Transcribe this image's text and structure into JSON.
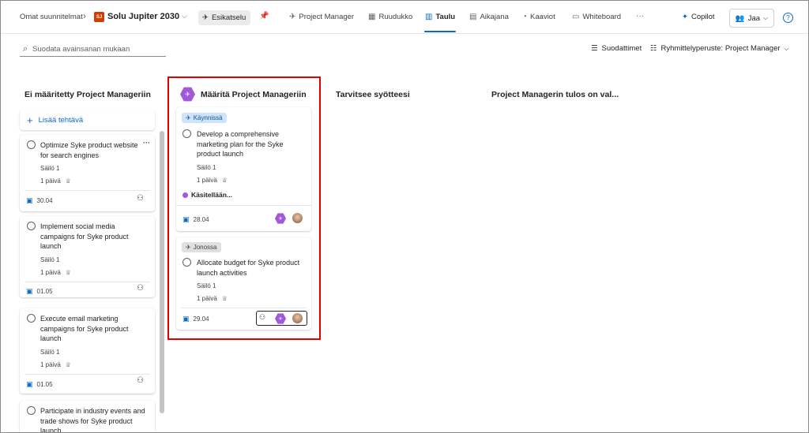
{
  "header": {
    "breadcrumb": "Omat suunnitelmat",
    "plan_initials": "SJ",
    "plan_name": "Solu Jupiter 2030",
    "preview_label": "Esikatselu",
    "tabs": [
      {
        "label": "Project Manager",
        "icon": "rocket-icon"
      },
      {
        "label": "Ruudukko",
        "icon": "grid-icon"
      },
      {
        "label": "Taulu",
        "icon": "board-icon"
      },
      {
        "label": "Aikajana",
        "icon": "timeline-icon"
      },
      {
        "label": "Kaaviot",
        "icon": "chart-icon"
      },
      {
        "label": "Whiteboard",
        "icon": "whiteboard-icon"
      }
    ],
    "more": "···",
    "copilot_label": "Copilot",
    "share_label": "Jaa",
    "help": "?"
  },
  "toolbar": {
    "search_placeholder": "Suodata avainsanan mukaan",
    "filters_label": "Suodattimet",
    "groupby_label": "Ryhmittelyperuste: Project Manager"
  },
  "columns": [
    {
      "title": "Ei määritetty Project Manageriin"
    },
    {
      "title": "Määritä Project Manageriin"
    },
    {
      "title": "Tarvitsee syötteesi"
    },
    {
      "title": "Project Managerin tulos on val..."
    }
  ],
  "add_task_label": "Lisää tehtävä",
  "unassigned_cards": [
    {
      "title_lines": [
        "Optimize Syke product website",
        "for search engines"
      ],
      "bucket": "Säilö 1",
      "duration": "1 päivä",
      "date": "30.04"
    },
    {
      "title_lines": [
        "Implement social media",
        "campaigns for Syke product",
        "launch"
      ],
      "bucket": "Säilö 1",
      "duration": "1 päivä",
      "date": "01.05"
    },
    {
      "title_lines": [
        "Execute email marketing",
        "campaigns for Syke product",
        "launch"
      ],
      "bucket": "Säilö 1",
      "duration": "1 päivä",
      "date": "01.05"
    },
    {
      "title_lines": [
        "Participate in industry events and",
        "trade shows for Syke product",
        "launch"
      ]
    }
  ],
  "assigned_cards": [
    {
      "status": "Käynnissä",
      "title_lines": [
        "Develop a comprehensive",
        "marketing plan for the Syke",
        "product launch"
      ],
      "bucket": "Säilö 1",
      "duration": "1 päivä",
      "processing": "Käsitellään...",
      "date": "28.04"
    },
    {
      "status": "Jonossa",
      "title_lines": [
        "Allocate budget for Syke product",
        "launch activities"
      ],
      "bucket": "Säilö 1",
      "duration": "1 päivä",
      "date": "29.04"
    }
  ],
  "colors": {
    "accent": "#0f6cbd",
    "agent": "#a259d9",
    "highlight": "#e00000"
  }
}
